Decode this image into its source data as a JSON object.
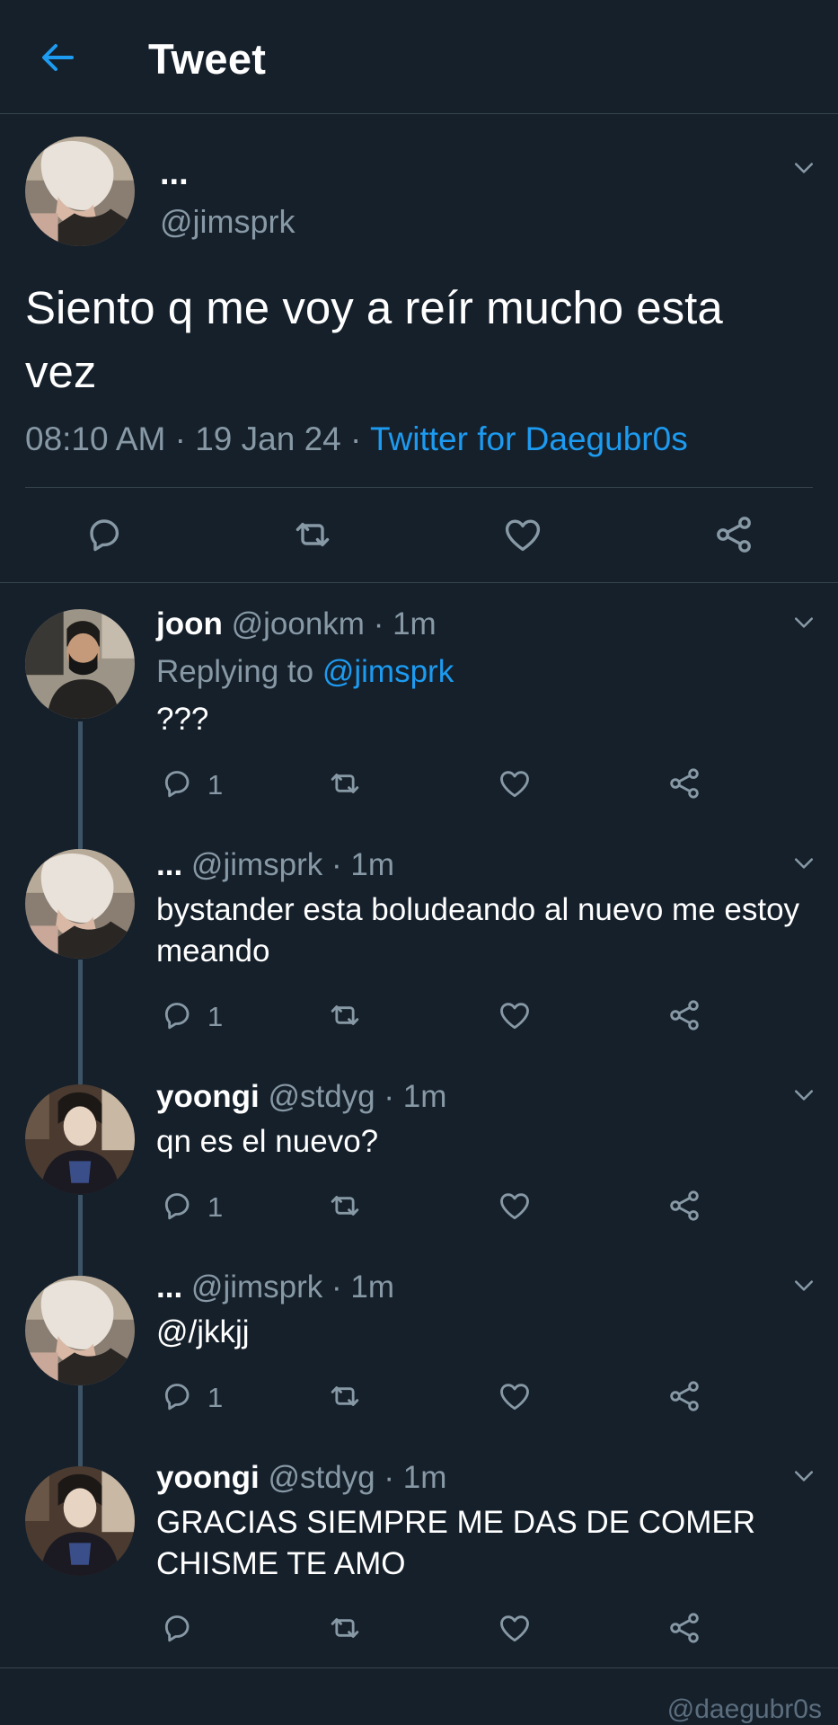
{
  "header": {
    "title": "Tweet",
    "back_icon": "arrow-left-icon",
    "accent": "#1d9bf0"
  },
  "main_tweet": {
    "name": "...",
    "handle": "@jimsprk",
    "text": "Siento q me voy a reír mucho esta vez",
    "time": "08:10 AM",
    "date": "19 Jan 24",
    "source": "Twitter for Daegubr0s",
    "actions": [
      "reply-icon",
      "retweet-icon",
      "like-icon",
      "share-icon"
    ]
  },
  "replies": [
    {
      "name": "joon",
      "handle": "@joonkm",
      "time": "1m",
      "replying_prefix": "Replying to",
      "replying_to": "@jimsprk",
      "text": "???",
      "reply_count": "1"
    },
    {
      "name": "...",
      "handle": "@jimsprk",
      "time": "1m",
      "text": "bystander esta boludeando al nuevo me estoy meando",
      "reply_count": "1"
    },
    {
      "name": "yoongi",
      "handle": "@stdyg",
      "time": "1m",
      "text": "qn es el nuevo?",
      "reply_count": "1"
    },
    {
      "name": "...",
      "handle": "@jimsprk",
      "time": "1m",
      "text": "@/jkkjj",
      "reply_count": "1"
    },
    {
      "name": "yoongi",
      "handle": "@stdyg",
      "time": "1m",
      "text": "GRACIAS SIEMPRE ME DAS DE COMER CHISME TE AMO",
      "reply_count": ""
    }
  ],
  "watermark": "@daegubr0s",
  "colors": {
    "background": "#15202b",
    "secondary_text": "#8899a6",
    "divider": "#38444d",
    "link": "#1d9bf0"
  }
}
